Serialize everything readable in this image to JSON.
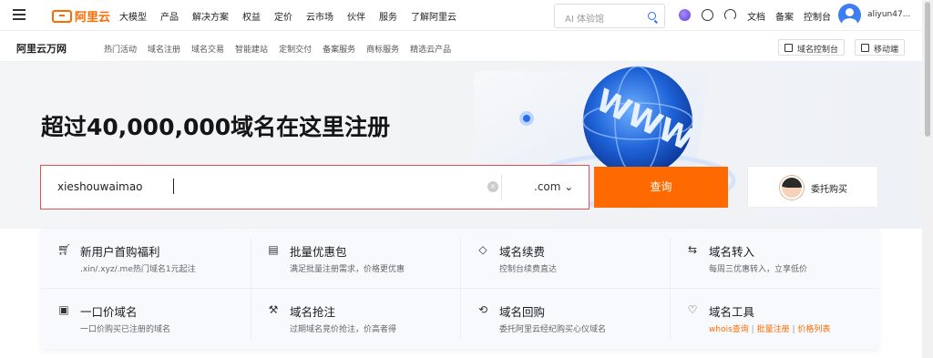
{
  "topbar": {
    "logo_text": "阿里云",
    "nav": [
      "大模型",
      "产品",
      "解决方案",
      "权益",
      "定价",
      "云市场",
      "伙伴",
      "服务",
      "了解阿里云"
    ],
    "search_placeholder": "AI 体验馆",
    "right_links": [
      "文档",
      "备案",
      "控制台"
    ],
    "username": "aliyun47..."
  },
  "subbar": {
    "brand": "阿里云万网",
    "items": [
      "热门活动",
      "域名注册",
      "域名交易",
      "智能建站",
      "定制交付",
      "备案服务",
      "商标服务",
      "精选云产品"
    ],
    "console_btn": "域名控制台",
    "mobile_btn": "移动端"
  },
  "hero": {
    "title": "超过40,000,000域名在这里注册",
    "search_value": "xieshouwaimao",
    "tld": ".com",
    "query_btn": "查询",
    "entrust_btn": "委托购买",
    "globe_text": "WWW"
  },
  "cards": [
    {
      "icon": "cart-icon",
      "title": "新用户首购福利",
      "desc": ".xin/.xyz/.me热门域名1元起注"
    },
    {
      "icon": "bag-icon",
      "title": "批量优惠包",
      "desc": "满足批量注册需求，价格更优惠"
    },
    {
      "icon": "tag-icon",
      "title": "域名续费",
      "desc": "控制台续费直达"
    },
    {
      "icon": "transfer-icon",
      "title": "域名转入",
      "desc": "每周三优惠转入，立享低价"
    },
    {
      "icon": "ticket-icon",
      "title": "一口价域名",
      "desc": "一口价购买已注册的域名"
    },
    {
      "icon": "gavel-icon",
      "title": "域名抢注",
      "desc": "过期域名竞价抢注，价高者得"
    },
    {
      "icon": "buyback-icon",
      "title": "域名回购",
      "desc": "委托阿里云经纪购买心仪域名"
    },
    {
      "icon": "heart-icon",
      "title": "域名工具",
      "links": [
        "whois查询",
        "批量注册",
        "价格列表"
      ]
    }
  ],
  "colors": {
    "brand": "#ff6a00",
    "search_border": "#e64f4f",
    "link": "#2a6df5"
  }
}
